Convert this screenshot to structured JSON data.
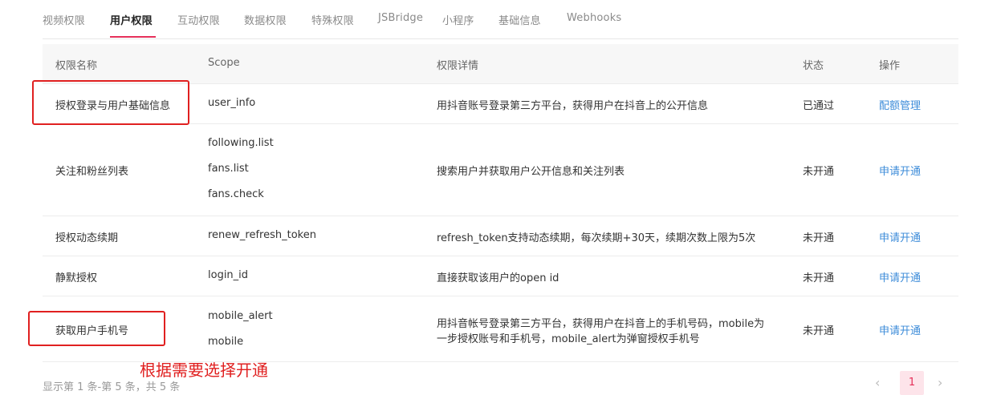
{
  "tabs": [
    "视频权限",
    "用户权限",
    "互动权限",
    "数据权限",
    "特殊权限",
    "JSBridge",
    "小程序",
    "基础信息",
    "Webhooks"
  ],
  "active_tab": "用户权限",
  "table": {
    "headers": {
      "name": "权限名称",
      "scope": "Scope",
      "detail": "权限详情",
      "status": "状态",
      "action": "操作"
    },
    "rows": [
      {
        "name": "授权登录与用户基础信息",
        "scopes": [
          "user_info"
        ],
        "detail": [
          "用抖音账号登录第三方平台，获得用户在抖音上的公开信息"
        ],
        "status": "已通过",
        "action": "配额管理"
      },
      {
        "name": "关注和粉丝列表",
        "scopes": [
          "following.list",
          "fans.list",
          "fans.check"
        ],
        "detail": [
          "搜索用户并获取用户公开信息和关注列表"
        ],
        "status": "未开通",
        "action": "申请开通"
      },
      {
        "name": "授权动态续期",
        "scopes": [
          "renew_refresh_token"
        ],
        "detail": [
          "refresh_token支持动态续期，每次续期+30天，续期次数上限为5次"
        ],
        "status": "未开通",
        "action": "申请开通"
      },
      {
        "name": "静默授权",
        "scopes": [
          "login_id"
        ],
        "detail": [
          "直接获取该用户的open id"
        ],
        "status": "未开通",
        "action": "申请开通"
      },
      {
        "name": "获取用户手机号",
        "scopes": [
          "mobile_alert",
          "mobile"
        ],
        "detail": [
          "用抖音帐号登录第三方平台，获得用户在抖音上的手机号码，mobile为",
          "一步授权账号和手机号，mobile_alert为弹窗授权手机号"
        ],
        "status": "未开通",
        "action": "申请开通"
      }
    ]
  },
  "annotation": {
    "text": "根据需要选择开通",
    "color": "#e02020"
  },
  "footer": {
    "summary": "显示第 1 条-第 5 条，共 5 条"
  },
  "pagination": {
    "current": "1",
    "prev": "‹",
    "next": "›"
  },
  "colors": {
    "accent": "#e5305a",
    "link": "#3d8cd9",
    "annotation": "#e02020"
  }
}
